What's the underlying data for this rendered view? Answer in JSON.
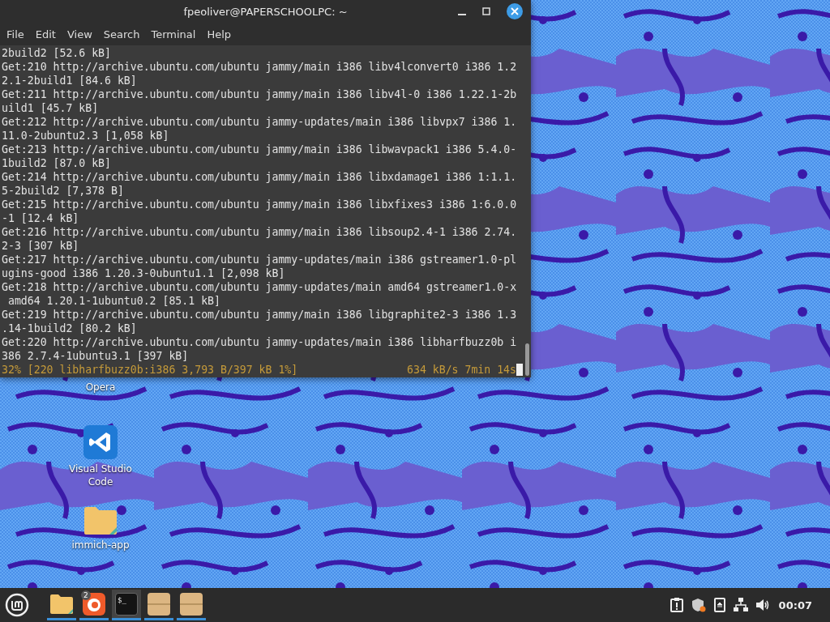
{
  "window": {
    "title": "fpeoliver@PAPERSCHOOLPC: ~",
    "menu": [
      "File",
      "Edit",
      "View",
      "Search",
      "Terminal",
      "Help"
    ],
    "lines": [
      "2build2 [52.6 kB]",
      "Get:210 http://archive.ubuntu.com/ubuntu jammy/main i386 libv4lconvert0 i386 1.2",
      "2.1-2build1 [84.6 kB]",
      "Get:211 http://archive.ubuntu.com/ubuntu jammy/main i386 libv4l-0 i386 1.22.1-2b",
      "uild1 [45.7 kB]",
      "Get:212 http://archive.ubuntu.com/ubuntu jammy-updates/main i386 libvpx7 i386 1.",
      "11.0-2ubuntu2.3 [1,058 kB]",
      "Get:213 http://archive.ubuntu.com/ubuntu jammy/main i386 libwavpack1 i386 5.4.0-",
      "1build2 [87.0 kB]",
      "Get:214 http://archive.ubuntu.com/ubuntu jammy/main i386 libxdamage1 i386 1:1.1.",
      "5-2build2 [7,378 B]",
      "Get:215 http://archive.ubuntu.com/ubuntu jammy/main i386 libxfixes3 i386 1:6.0.0",
      "-1 [12.4 kB]",
      "Get:216 http://archive.ubuntu.com/ubuntu jammy/main i386 libsoup2.4-1 i386 2.74.",
      "2-3 [307 kB]",
      "Get:217 http://archive.ubuntu.com/ubuntu jammy-updates/main i386 gstreamer1.0-pl",
      "ugins-good i386 1.20.3-0ubuntu1.1 [2,098 kB]",
      "Get:218 http://archive.ubuntu.com/ubuntu jammy-updates/main amd64 gstreamer1.0-x",
      " amd64 1.20.1-1ubuntu0.2 [85.1 kB]",
      "Get:219 http://archive.ubuntu.com/ubuntu jammy/main i386 libgraphite2-3 i386 1.3",
      ".14-1build2 [80.2 kB]",
      "Get:220 http://archive.ubuntu.com/ubuntu jammy-updates/main i386 libharfbuzz0b i",
      "386 2.7.4-1ubuntu3.1 [397 kB]"
    ],
    "status": {
      "left": "32% [220 libharfbuzz0b:i386 3,793 B/397 kB 1%]",
      "right": "634 kB/s 7min 14s"
    }
  },
  "desktop_icons": [
    {
      "kind": "label-only",
      "label": "Opera"
    },
    {
      "kind": "code",
      "label": "Visual Studio Code"
    },
    {
      "kind": "folder",
      "label": "immich-app"
    }
  ],
  "taskbar": {
    "apps": [
      {
        "kind": "folder",
        "active": false
      },
      {
        "kind": "browser",
        "badge": "2",
        "active": false
      },
      {
        "kind": "terminal",
        "glyph": "$_",
        "active": true
      },
      {
        "kind": "box",
        "active": false
      },
      {
        "kind": "box",
        "active": false
      }
    ],
    "tray": [
      {
        "kind": "clipboard"
      },
      {
        "kind": "shield"
      },
      {
        "kind": "eject"
      },
      {
        "kind": "network"
      },
      {
        "kind": "volume"
      }
    ],
    "clock": "00:07"
  }
}
